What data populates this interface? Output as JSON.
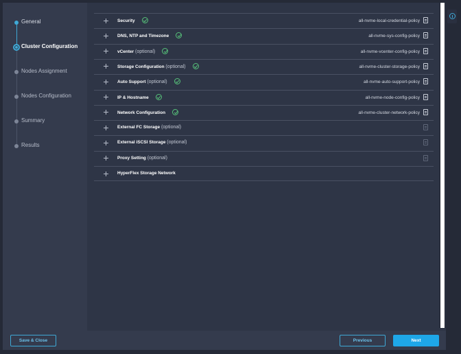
{
  "steps": [
    {
      "label": "General",
      "state": "done"
    },
    {
      "label": "Cluster Configuration",
      "state": "current"
    },
    {
      "label": "Nodes Assignment",
      "state": "pending"
    },
    {
      "label": "Nodes Configuration",
      "state": "pending"
    },
    {
      "label": "Summary",
      "state": "pending"
    },
    {
      "label": "Results",
      "state": "pending"
    }
  ],
  "sections": [
    {
      "name": "Security",
      "optional": "",
      "policy": "all-nvme-local-credential-policy",
      "checked": true
    },
    {
      "name": "DNS, NTP and Timezone",
      "optional": "",
      "policy": "all-nvme-sys-config-policy",
      "checked": true
    },
    {
      "name": "vCenter",
      "optional": "(optional)",
      "policy": "all-nvme-vcenter-config-policy",
      "checked": true
    },
    {
      "name": "Storage Configuration",
      "optional": "(optional)",
      "policy": "all-nvme-cluster-storage-policy",
      "checked": true
    },
    {
      "name": "Auto Support",
      "optional": "(optional)",
      "policy": "all-nvme-auto-support-policy",
      "checked": true
    },
    {
      "name": "IP & Hostname",
      "optional": "",
      "policy": "all-nvme-node-config-policy",
      "checked": true
    },
    {
      "name": "Network Configuration",
      "optional": "",
      "policy": "all-nvme-cluster-network-policy",
      "checked": true
    },
    {
      "name": "External FC Storage",
      "optional": "(optional)",
      "policy": "",
      "checked": false
    },
    {
      "name": "External iSCSI Storage",
      "optional": "(optional)",
      "policy": "",
      "checked": false
    },
    {
      "name": "Proxy Setting",
      "optional": "(optional)",
      "policy": "",
      "checked": false
    },
    {
      "name": "HyperFlex Storage Network",
      "optional": "",
      "policy": "",
      "checked": false,
      "no_icon": true
    }
  ],
  "footer": {
    "save_label": "Save & Close",
    "previous_label": "Previous",
    "next_label": "Next"
  },
  "colors": {
    "accent": "#1ea7e8",
    "check": "#57c27a",
    "background": "#2e3546"
  }
}
